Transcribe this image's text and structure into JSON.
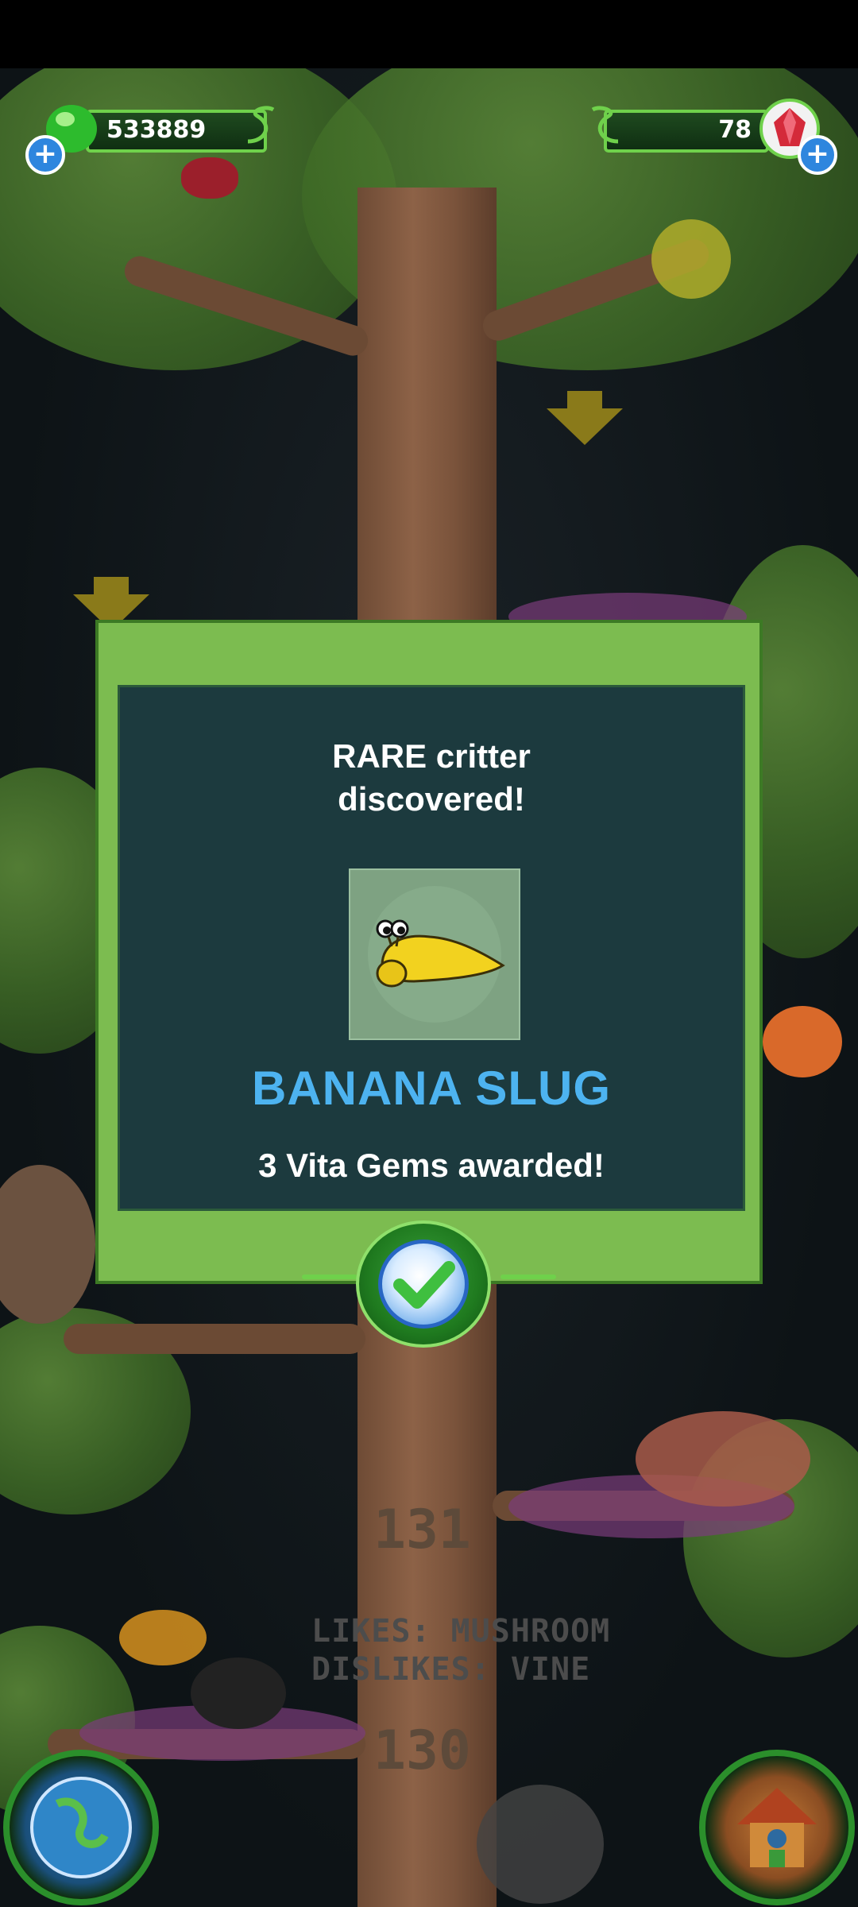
{
  "hud": {
    "jelly_count": "533889",
    "gem_count": "78"
  },
  "modal": {
    "title_line1": "RARE critter",
    "title_line2": "discovered!",
    "critter_name": "BANANA SLUG",
    "reward_text": "3 Vita Gems awarded!"
  },
  "scene": {
    "likes_text": "LIKES: MUSHROOM",
    "dislikes_text": "DISLIKES: VINE",
    "level_upper": "131",
    "level_lower": "130"
  },
  "colors": {
    "accent_green": "#7cbc50",
    "modal_panel": "#1c3a3e",
    "critter_name": "#4db3f0"
  }
}
